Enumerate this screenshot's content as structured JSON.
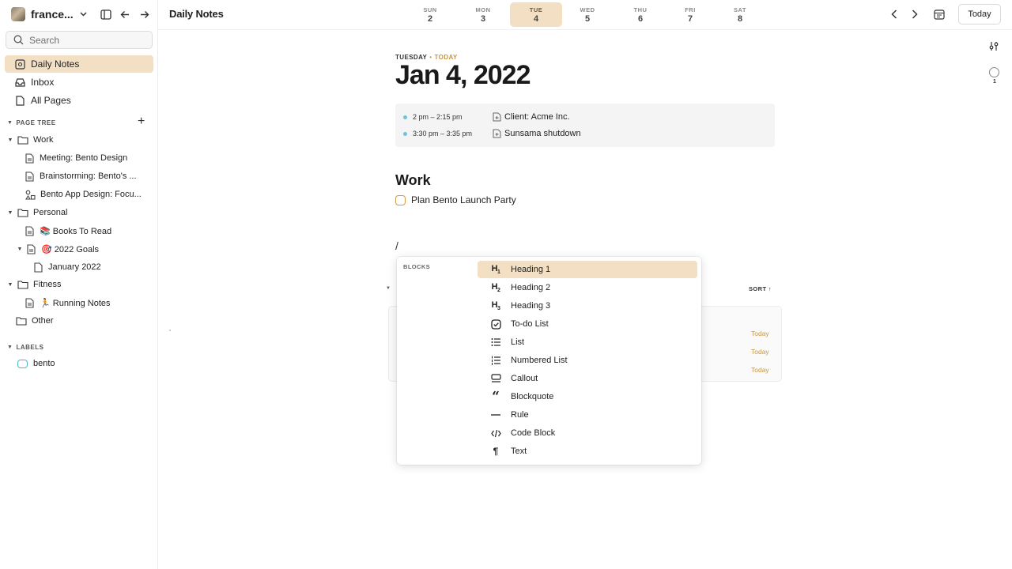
{
  "workspace": {
    "name": "france..."
  },
  "search": {
    "placeholder": "Search"
  },
  "nav": {
    "daily_notes": "Daily Notes",
    "inbox": "Inbox",
    "all_pages": "All Pages"
  },
  "page_tree": {
    "header": "PAGE TREE",
    "work": "Work",
    "work_items": [
      "Meeting: Bento Design",
      "Brainstorming: Bento's ...",
      "Bento App Design: Focu..."
    ],
    "personal": "Personal",
    "books": "📚 Books To Read",
    "goals": "🎯 2022 Goals",
    "january": "January 2022",
    "fitness": "Fitness",
    "running": "🏃 Running Notes",
    "other": "Other"
  },
  "labels": {
    "header": "LABELS",
    "items": [
      "bento"
    ]
  },
  "header": {
    "title": "Daily Notes",
    "today_button": "Today",
    "days": [
      {
        "name": "SUN",
        "num": "2"
      },
      {
        "name": "MON",
        "num": "3"
      },
      {
        "name": "TUE",
        "num": "4"
      },
      {
        "name": "WED",
        "num": "5"
      },
      {
        "name": "THU",
        "num": "6"
      },
      {
        "name": "FRI",
        "num": "7"
      },
      {
        "name": "SAT",
        "num": "8"
      }
    ],
    "selected_day": "TUE"
  },
  "main": {
    "weekday": "TUESDAY",
    "today_tag": "TODAY",
    "date": "Jan 4, 2022",
    "events": [
      {
        "time": "2 pm – 2:15 pm",
        "title": "Client: Acme Inc."
      },
      {
        "time": "3:30 pm – 3:35 pm",
        "title": "Sunsama shutdown"
      }
    ],
    "section_heading": "Work",
    "todo": "Plan Bento Launch Party",
    "slash_text": "/",
    "sort_label": "SORT ↑",
    "today_labels": [
      "Today",
      "Today",
      "Today"
    ],
    "outline_count": "1"
  },
  "popup": {
    "header": "BLOCKS",
    "items": [
      {
        "label": "Heading 1",
        "icon": "heading-1"
      },
      {
        "label": "Heading 2",
        "icon": "heading-2"
      },
      {
        "label": "Heading 3",
        "icon": "heading-3"
      },
      {
        "label": "To-do List",
        "icon": "todo-check"
      },
      {
        "label": "List",
        "icon": "bullet-list"
      },
      {
        "label": "Numbered List",
        "icon": "numbered-list"
      },
      {
        "label": "Callout",
        "icon": "callout"
      },
      {
        "label": "Blockquote",
        "icon": "quote"
      },
      {
        "label": "Rule",
        "icon": "rule"
      },
      {
        "label": "Code Block",
        "icon": "code"
      },
      {
        "label": "Text",
        "icon": "paragraph"
      }
    ],
    "selected_index": 0
  },
  "colors": {
    "accent": "#f2dfc4",
    "accent_text": "#c9963f",
    "event_dot": "#6fc3d6",
    "label": "#4fb6c9"
  }
}
